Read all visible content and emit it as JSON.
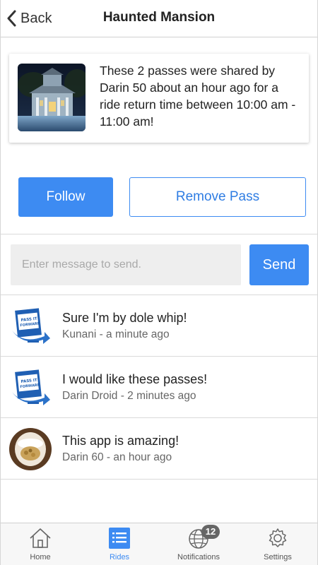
{
  "header": {
    "back_label": "Back",
    "title": "Haunted Mansion"
  },
  "share_card": {
    "message": "These 2 passes were shared by Darin 50 about an hour ago for a ride return time between 10:00 am - 11:00 am!",
    "thumbnail_icon": "haunted-mansion-photo"
  },
  "actions": {
    "follow_label": "Follow",
    "remove_label": "Remove Pass"
  },
  "composer": {
    "placeholder": "Enter message to send.",
    "value": "",
    "send_label": "Send"
  },
  "messages": [
    {
      "text": "Sure I'm by dole whip!",
      "meta": "Kunani - a minute ago",
      "avatar": "pass-it-forward-logo"
    },
    {
      "text": "I would like these passes!",
      "meta": "Darin Droid - 2 minutes ago",
      "avatar": "pass-it-forward-logo"
    },
    {
      "text": "This app is amazing!",
      "meta": "Darin 60 - an hour ago",
      "avatar": "user-photo"
    }
  ],
  "tabbar": {
    "tabs": [
      {
        "label": "Home",
        "icon": "home-icon",
        "active": false
      },
      {
        "label": "Rides",
        "icon": "list-icon",
        "active": true
      },
      {
        "label": "Notifications",
        "icon": "globe-icon",
        "active": false,
        "badge": "12"
      },
      {
        "label": "Settings",
        "icon": "gear-icon",
        "active": false
      }
    ]
  },
  "colors": {
    "accent": "#3d8bf2",
    "input_bg": "#eeeeee",
    "badge_bg": "#666666"
  }
}
